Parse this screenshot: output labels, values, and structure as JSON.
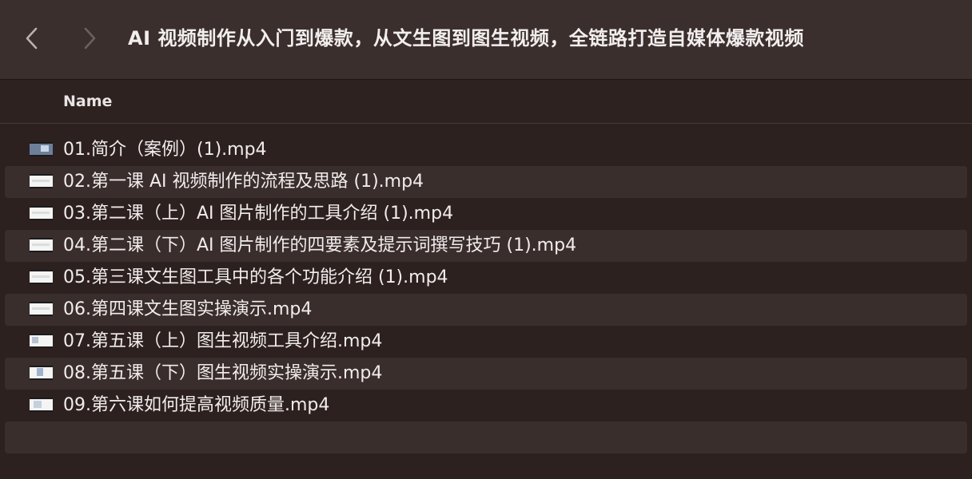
{
  "window": {
    "title": "AI 视频制作从入门到爆款，从文生图到图生视频，全链路打造自媒体爆款视频"
  },
  "toolbar": {
    "back_icon": "chevron-left-icon",
    "forward_icon": "chevron-right-icon"
  },
  "columns": {
    "name_label": "Name"
  },
  "files": [
    {
      "name": "01.简介（案例）(1).mp4",
      "icon": "video-thumbnail-icon"
    },
    {
      "name": "02.第一课 AI 视频制作的流程及思路 (1).mp4",
      "icon": "video-thumbnail-icon"
    },
    {
      "name": "03.第二课（上）AI 图片制作的工具介绍 (1).mp4",
      "icon": "video-thumbnail-icon"
    },
    {
      "name": "04.第二课（下）AI 图片制作的四要素及提示词撰写技巧 (1).mp4",
      "icon": "video-thumbnail-icon"
    },
    {
      "name": "05.第三课文生图工具中的各个功能介绍 (1).mp4",
      "icon": "video-thumbnail-icon"
    },
    {
      "name": "06.第四课文生图实操演示.mp4",
      "icon": "video-thumbnail-icon"
    },
    {
      "name": "07.第五课（上）图生视频工具介绍.mp4",
      "icon": "video-thumbnail-icon"
    },
    {
      "name": "08.第五课（下）图生视频实操演示.mp4",
      "icon": "video-thumbnail-icon"
    },
    {
      "name": "09.第六课如何提高视频质量.mp4",
      "icon": "video-thumbnail-icon"
    }
  ],
  "colors": {
    "background": "#2d2120",
    "toolbar": "#3b2f2e",
    "row_alt": "#3a2e2d",
    "text": "#f1eded"
  }
}
